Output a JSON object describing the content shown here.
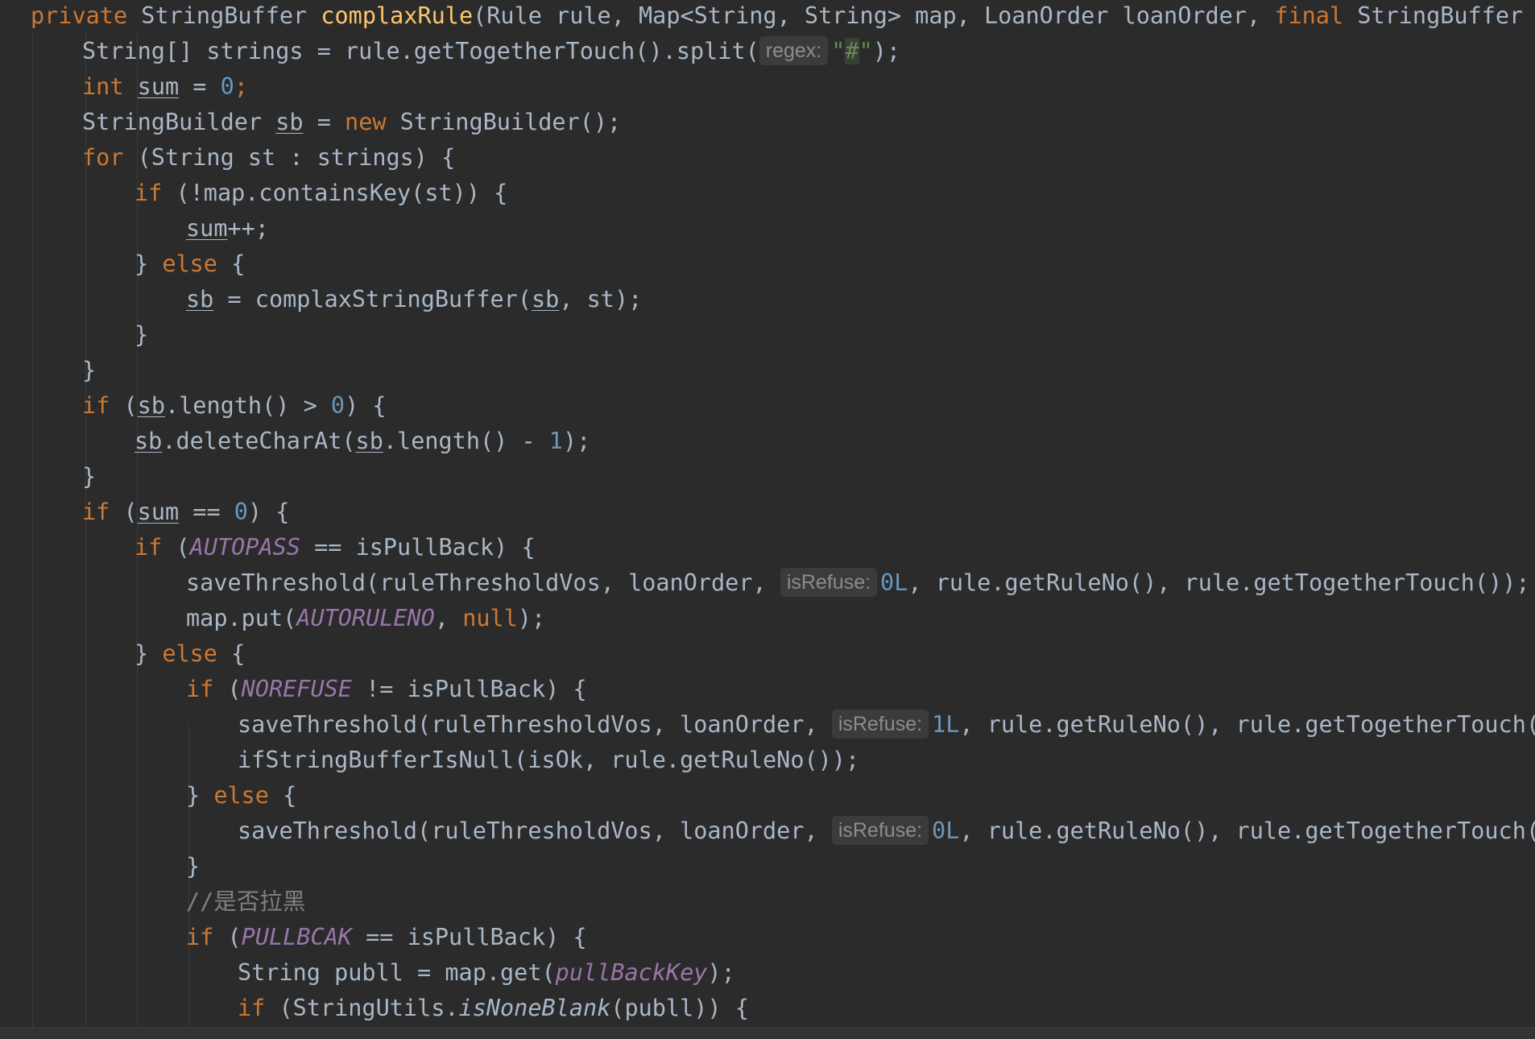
{
  "code": {
    "l1": {
      "p1": "private",
      "p2": "StringBuffer",
      "p3": "complaxRule",
      "p4": "(Rule rule, Map<String, String> map, LoanOrder loanOrder, ",
      "p5": "final",
      "p6": "StringBuffer isOk, Li"
    },
    "l2": {
      "p1": "String[] strings = rule.getTogetherTouch().split(",
      "hint": "regex:",
      "p2": "\"",
      "p3": "#",
      "p4": "\"",
      "p5": ");"
    },
    "l3": {
      "p1": "int",
      "p2": "sum",
      "p3": " = ",
      "p4": "0",
      "p5": ";"
    },
    "l4": {
      "p1": "StringBuilder ",
      "p2": "sb",
      "p3": " = ",
      "p4": "new",
      "p5": " StringBuilder();"
    },
    "l5": {
      "p1": "for",
      "p2": " (String st : strings) {"
    },
    "l6": {
      "p1": "if",
      "p2": " (!map.containsKey(st)) {"
    },
    "l7": {
      "p1": "sum",
      "p2": "++;"
    },
    "l8": {
      "p1": "} ",
      "p2": "else",
      "p3": " {"
    },
    "l9": {
      "p1": "sb",
      "p2": " = complaxStringBuffer(",
      "p3": "sb",
      "p4": ", st);"
    },
    "l10": {
      "p1": "}"
    },
    "l11": {
      "p1": "}"
    },
    "l12": {
      "p1": "if",
      "p2": " (",
      "p3": "sb",
      "p4": ".length() > ",
      "p5": "0",
      "p6": ") {"
    },
    "l13": {
      "p1": "sb",
      "p2": ".deleteCharAt(",
      "p3": "sb",
      "p4": ".length() - ",
      "p5": "1",
      "p6": ");"
    },
    "l14": {
      "p1": "}"
    },
    "l15": {
      "p1": "if",
      "p2": " (",
      "p3": "sum",
      "p4": " == ",
      "p5": "0",
      "p6": ") {"
    },
    "l16": {
      "p1": "if",
      "p2": " (",
      "p3": "AUTOPASS",
      "p4": " == isPullBack) {"
    },
    "l17": {
      "p1": "saveThreshold(ruleThresholdVos, loanOrder, ",
      "hint": "isRefuse:",
      "p2": "0L",
      "p3": ", rule.getRuleNo(), rule.getTogetherTouch());"
    },
    "l18": {
      "p1": "map.put(",
      "p2": "AUTORULENO",
      "p3": ", ",
      "p4": "null",
      "p5": ");"
    },
    "l19": {
      "p1": "} ",
      "p2": "else",
      "p3": " {"
    },
    "l20": {
      "p1": "if",
      "p2": " (",
      "p3": "NOREFUSE",
      "p4": " != isPullBack) {"
    },
    "l21": {
      "p1": "saveThreshold(ruleThresholdVos, loanOrder, ",
      "hint": "isRefuse:",
      "p2": "1L",
      "p3": ", rule.getRuleNo(), rule.getTogetherTouch());"
    },
    "l22": {
      "p1": "ifStringBufferIsNull(isOk, rule.getRuleNo());"
    },
    "l23": {
      "p1": "} ",
      "p2": "else",
      "p3": " {"
    },
    "l24": {
      "p1": "saveThreshold(ruleThresholdVos, loanOrder, ",
      "hint": "isRefuse:",
      "p2": "0L",
      "p3": ", rule.getRuleNo(), rule.getTogetherTouch());"
    },
    "l25": {
      "p1": "}"
    },
    "l26": {
      "p1": "//是否拉黑"
    },
    "l27": {
      "p1": "if",
      "p2": " (",
      "p3": "PULLBCAK",
      "p4": " == isPullBack) {"
    },
    "l28": {
      "p1": "String publl = map.get(",
      "p2": "pullBackKey",
      "p3": ");"
    },
    "l29": {
      "p1": "if",
      "p2": " (StringUtils.",
      "p3": "isNoneBlank",
      "p4": "(publl)) {"
    }
  },
  "colors": {
    "background": "#2b2b2b",
    "default_text": "#a9b7c6",
    "keyword": "#cc7832",
    "method_declaration": "#ffc66d",
    "number": "#6897bb",
    "string": "#6a8759",
    "comment": "#808080",
    "constant": "#9876aa",
    "inlay_hint_bg": "#3b3b3b"
  }
}
